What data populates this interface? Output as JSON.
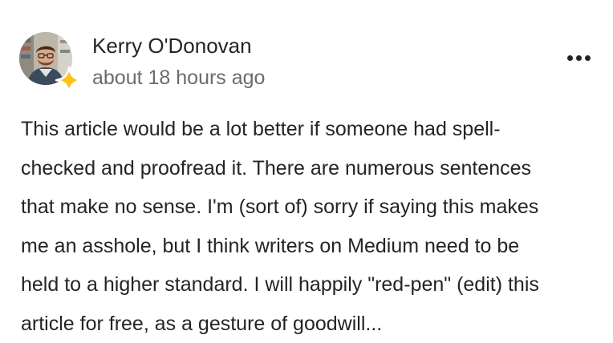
{
  "comment": {
    "author_name": "Kerry O'Donovan",
    "timestamp": "about 18 hours ago",
    "more_icon": "more-horizontal-icon",
    "member_badge_icon": "sparkle-star-icon",
    "member_badge_color": "#FFC017",
    "author_text_color": "#242424",
    "timestamp_color": "#6B6B6B",
    "body_lines": [
      "This article would be a lot better if someone had spell-",
      "checked and proofread it. There are numerous sentences",
      "that make no sense. I'm (sort of) sorry if saying this makes",
      "me an asshole, but I think writers on Medium need to be",
      "held to a higher standard. I will happily \"red-pen\" (edit) this",
      "article for free, as a gesture of goodwill..."
    ]
  }
}
